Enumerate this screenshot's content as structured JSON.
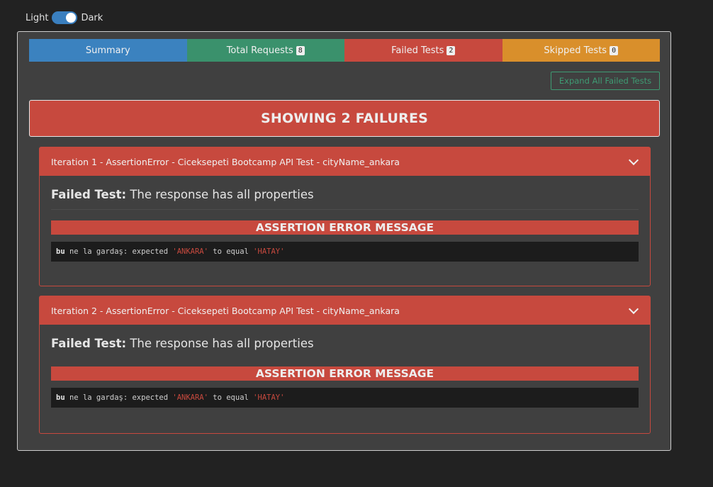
{
  "theme_toggle": {
    "light_label": "Light",
    "dark_label": "Dark",
    "state": "dark"
  },
  "tabs": [
    {
      "label": "Summary",
      "color": "#3b82bf"
    },
    {
      "label": "Total Requests",
      "badge": "8",
      "color": "#3a916c"
    },
    {
      "label": "Failed Tests",
      "badge": "2",
      "color": "#c7493e"
    },
    {
      "label": "Skipped Tests",
      "badge": "0",
      "color": "#d98f2b"
    }
  ],
  "expand_button": "Expand All Failed Tests",
  "banner": "SHOWING 2 FAILURES",
  "failures": [
    {
      "header": "Iteration 1 - AssertionError - Ciceksepeti Bootcamp API Test - cityName_ankara",
      "failed_test_label": "Failed Test:",
      "failed_test_name": "The response has all properties",
      "assertion_title": "ASSERTION ERROR MESSAGE",
      "message": {
        "prefix_bold": "bu",
        "prefix_rest": " ne la gardaş: expected ",
        "actual": "'ANKARA'",
        "middle": " to equal ",
        "expected": "'HATAY'"
      }
    },
    {
      "header": "Iteration 2 - AssertionError - Ciceksepeti Bootcamp API Test - cityName_ankara",
      "failed_test_label": "Failed Test:",
      "failed_test_name": "The response has all properties",
      "assertion_title": "ASSERTION ERROR MESSAGE",
      "message": {
        "prefix_bold": "bu",
        "prefix_rest": " ne la gardaş: expected ",
        "actual": "'ANKARA'",
        "middle": " to equal ",
        "expected": "'HATAY'"
      }
    }
  ]
}
